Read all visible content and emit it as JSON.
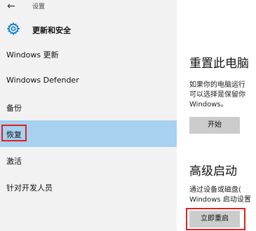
{
  "window": {
    "back_glyph": "←",
    "app_title": "设置"
  },
  "section": {
    "icon": "gear-icon",
    "title": "更新和安全"
  },
  "nav": {
    "items": [
      {
        "label": "Windows 更新"
      },
      {
        "label": "Windows Defender"
      },
      {
        "label": "备份"
      },
      {
        "label": "恢复"
      },
      {
        "label": "激活"
      },
      {
        "label": "针对开发人员"
      }
    ],
    "active_index": 3
  },
  "main": {
    "reset": {
      "heading": "重置此电脑",
      "desc_line1": "如果你的电脑运行",
      "desc_line2": "可以选择是保留你",
      "desc_line3": "Windows。",
      "button": "开始"
    },
    "advanced": {
      "heading": "高级启动",
      "desc_line1": "通过设备或磁盘(",
      "desc_line2": "Windows 启动设置",
      "button": "立即重启"
    }
  },
  "colors": {
    "sidebar_bg": "#f2f2f2",
    "active_bg": "#a6d1ef",
    "accent": "#0078d7",
    "highlight_red": "#e02020",
    "button_bg": "#cccccc"
  }
}
